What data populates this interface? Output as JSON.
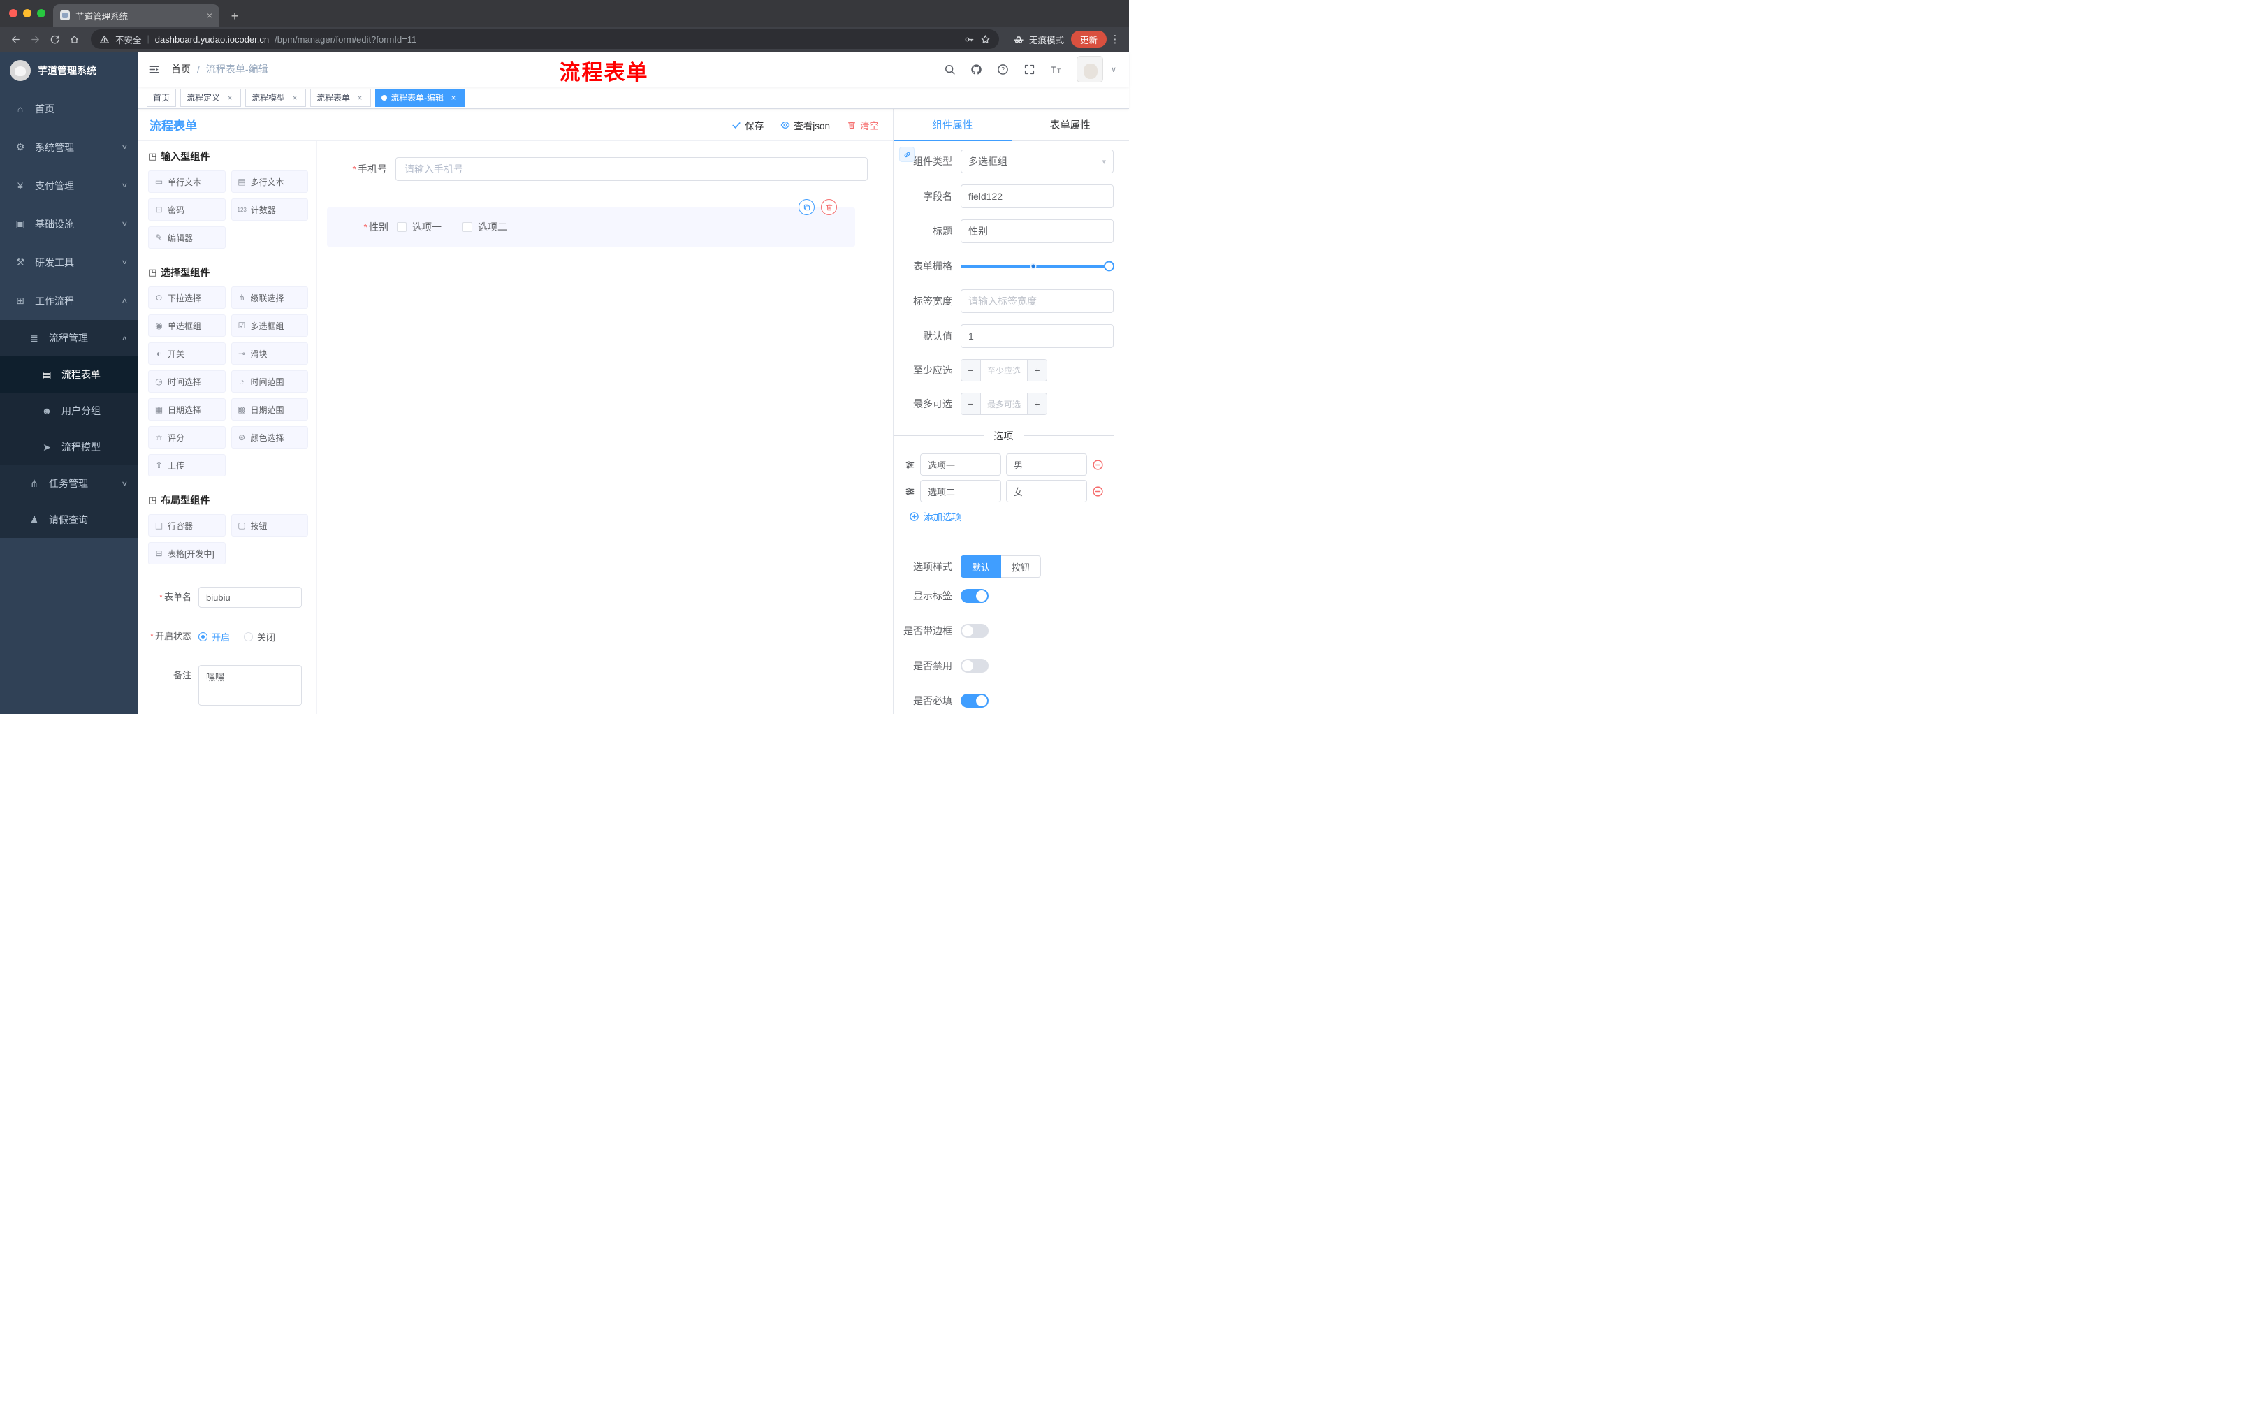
{
  "colors": {
    "accent": "#409eff",
    "danger": "#f56c6c",
    "annotation_red": "#ff0000",
    "sidebar_bg": "#304156",
    "update_button": "#d9503f",
    "selected_block_bg": "#f6f7ff"
  },
  "browser": {
    "tab_title": "芋道管理系统",
    "security_label": "不安全",
    "url_domain": "dashboard.yudao.iocoder.cn",
    "url_path": "/bpm/manager/form/edit?formId=11",
    "incognito_label": "无痕模式",
    "update_label": "更新"
  },
  "sidebar": {
    "logo_title": "芋道管理系统",
    "menu": [
      {
        "label": "首页",
        "icon": "home-icon",
        "glyph": "⌂"
      },
      {
        "label": "系统管理",
        "icon": "gear-icon",
        "glyph": "⚙",
        "chevron": "down"
      },
      {
        "label": "支付管理",
        "icon": "yen-icon",
        "glyph": "¥",
        "chevron": "down"
      },
      {
        "label": "基础设施",
        "icon": "infrastructure-icon",
        "glyph": "▣",
        "chevron": "down"
      },
      {
        "label": "研发工具",
        "icon": "dev-tools-icon",
        "glyph": "⚒",
        "chevron": "down"
      },
      {
        "label": "工作流程",
        "icon": "workflow-icon",
        "glyph": "⊞",
        "chevron": "up",
        "expanded": true,
        "children": [
          {
            "label": "流程管理",
            "icon": "process-management-icon",
            "glyph": "≣",
            "chevron": "up",
            "expanded": true,
            "children": [
              {
                "label": "流程表单",
                "icon": "process-form-icon",
                "glyph": "▤",
                "active": true
              },
              {
                "label": "用户分组",
                "icon": "user-group-icon",
                "glyph": "☻"
              },
              {
                "label": "流程模型",
                "icon": "process-model-icon",
                "glyph": "➤"
              }
            ]
          },
          {
            "label": "任务管理",
            "icon": "task-management-icon",
            "glyph": "⋔",
            "chevron": "down"
          },
          {
            "label": "请假查询",
            "icon": "leave-query-icon",
            "glyph": "♟"
          }
        ]
      }
    ]
  },
  "header": {
    "breadcrumb_home": "首页",
    "breadcrumb_current": "流程表单-编辑",
    "annotation": "流程表单"
  },
  "tags": [
    {
      "label": "首页",
      "closable": false,
      "active": false
    },
    {
      "label": "流程定义",
      "closable": true,
      "active": false
    },
    {
      "label": "流程模型",
      "closable": true,
      "active": false
    },
    {
      "label": "流程表单",
      "closable": true,
      "active": false
    },
    {
      "label": "流程表单-编辑",
      "closable": true,
      "active": true
    }
  ],
  "editor": {
    "title": "流程表单",
    "actions": {
      "save": "保存",
      "view_json": "查看json",
      "clear": "清空"
    },
    "palette_groups": [
      {
        "title": "输入型组件",
        "items": [
          {
            "label": "单行文本",
            "icon": "single-line-text-icon",
            "glyph": "▭"
          },
          {
            "label": "多行文本",
            "icon": "multi-line-text-icon",
            "glyph": "▤"
          },
          {
            "label": "密码",
            "icon": "password-icon",
            "glyph": "⊡"
          },
          {
            "label": "计数器",
            "icon": "counter-icon",
            "glyph": "123"
          },
          {
            "label": "编辑器",
            "icon": "editor-icon",
            "glyph": "✎"
          }
        ]
      },
      {
        "title": "选择型组件",
        "items": [
          {
            "label": "下拉选择",
            "icon": "select-icon",
            "glyph": "⊙"
          },
          {
            "label": "级联选择",
            "icon": "cascader-icon",
            "glyph": "⋔"
          },
          {
            "label": "单选框组",
            "icon": "radio-group-icon",
            "glyph": "◉"
          },
          {
            "label": "多选框组",
            "icon": "checkbox-group-icon",
            "glyph": "☑"
          },
          {
            "label": "开关",
            "icon": "switch-icon",
            "glyph": "◐"
          },
          {
            "label": "滑块",
            "icon": "slider-icon",
            "glyph": "⊸"
          },
          {
            "label": "时间选择",
            "icon": "time-picker-icon",
            "glyph": "◷"
          },
          {
            "label": "时间范围",
            "icon": "time-range-icon",
            "glyph": "◔"
          },
          {
            "label": "日期选择",
            "icon": "date-picker-icon",
            "glyph": "▦"
          },
          {
            "label": "日期范围",
            "icon": "date-range-icon",
            "glyph": "▩"
          },
          {
            "label": "评分",
            "icon": "rate-icon",
            "glyph": "☆"
          },
          {
            "label": "颜色选择",
            "icon": "color-picker-icon",
            "glyph": "⊛"
          },
          {
            "label": "上传",
            "icon": "upload-icon",
            "glyph": "⇧"
          }
        ]
      },
      {
        "title": "布局型组件",
        "items": [
          {
            "label": "行容器",
            "icon": "row-container-icon",
            "glyph": "◫"
          },
          {
            "label": "按钮",
            "icon": "button-icon",
            "glyph": "▢"
          },
          {
            "label": "表格[开发中]",
            "icon": "table-icon",
            "glyph": "⊞"
          }
        ]
      }
    ],
    "meta": {
      "form_name_label": "表单名",
      "form_name_value": "biubiu",
      "status_label": "开启状态",
      "status_on": "开启",
      "status_off": "关闭",
      "status_selected": "开启",
      "remark_label": "备注",
      "remark_value": "嘿嘿"
    }
  },
  "canvas": {
    "phone": {
      "label": "手机号",
      "required": true,
      "placeholder": "请输入手机号"
    },
    "gender": {
      "label": "性别",
      "required": true,
      "options": [
        "选项一",
        "选项二"
      ],
      "selected": true
    }
  },
  "props": {
    "tab_component": "组件属性",
    "tab_form": "表单属性",
    "rows": {
      "component_type": {
        "label": "组件类型",
        "value": "多选框组"
      },
      "field_name": {
        "label": "字段名",
        "value": "field122"
      },
      "title": {
        "label": "标题",
        "value": "性别"
      },
      "grid": {
        "label": "表单栅格"
      },
      "label_width": {
        "label": "标签宽度",
        "placeholder": "请输入标签宽度"
      },
      "default_value": {
        "label": "默认值",
        "value": "1"
      },
      "min_select": {
        "label": "至少应选",
        "placeholder": "至少应选"
      },
      "max_select": {
        "label": "最多可选",
        "placeholder": "最多可选"
      }
    },
    "options_title": "选项",
    "options": [
      {
        "label": "选项一",
        "value": "男"
      },
      {
        "label": "选项二",
        "value": "女"
      }
    ],
    "add_option": "添加选项",
    "option_style": {
      "label": "选项样式",
      "options": [
        "默认",
        "按钮"
      ],
      "selected": "默认"
    },
    "switches": [
      {
        "label": "显示标签",
        "on": true
      },
      {
        "label": "是否带边框",
        "on": false
      },
      {
        "label": "是否禁用",
        "on": false
      },
      {
        "label": "是否必填",
        "on": true
      }
    ]
  }
}
